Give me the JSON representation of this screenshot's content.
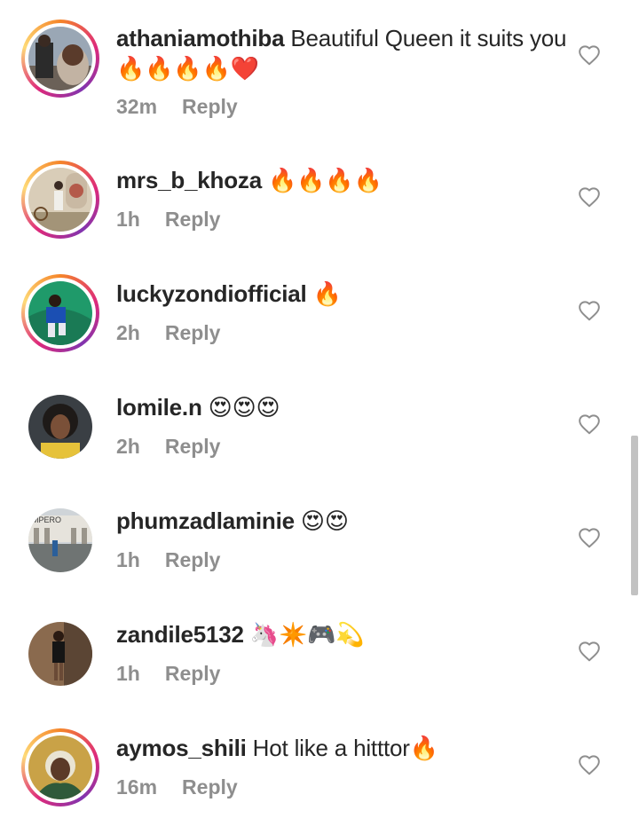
{
  "comments": [
    {
      "username": "athaniamothiba",
      "text": " Beautiful Queen it suits you 🔥🔥🔥🔥❤️",
      "time": "32m",
      "reply": "Reply"
    },
    {
      "username": "mrs_b_khoza",
      "text": " 🔥🔥🔥🔥",
      "time": "1h",
      "reply": "Reply"
    },
    {
      "username": "luckyzondiofficial",
      "text": " 🔥",
      "time": "2h",
      "reply": "Reply"
    },
    {
      "username": "lomile.n",
      "text": " 😍😍😍",
      "time": "2h",
      "reply": "Reply"
    },
    {
      "username": "phumzadlaminie",
      "text": " 😍😍",
      "time": "1h",
      "reply": "Reply"
    },
    {
      "username": "zandile5132",
      "text": " 🦄✴️🎮💫",
      "time": "1h",
      "reply": "Reply"
    },
    {
      "username": "aymos_shili",
      "text": " Hot like a hitttor🔥",
      "time": "16m",
      "reply": "Reply"
    }
  ],
  "avatar_photo_text": "MPERO",
  "icons": {
    "like": "heart-outline-icon"
  },
  "colors": {
    "text": "#262626",
    "meta": "#8e8e8e",
    "story_ring": "#dd2a7b"
  }
}
